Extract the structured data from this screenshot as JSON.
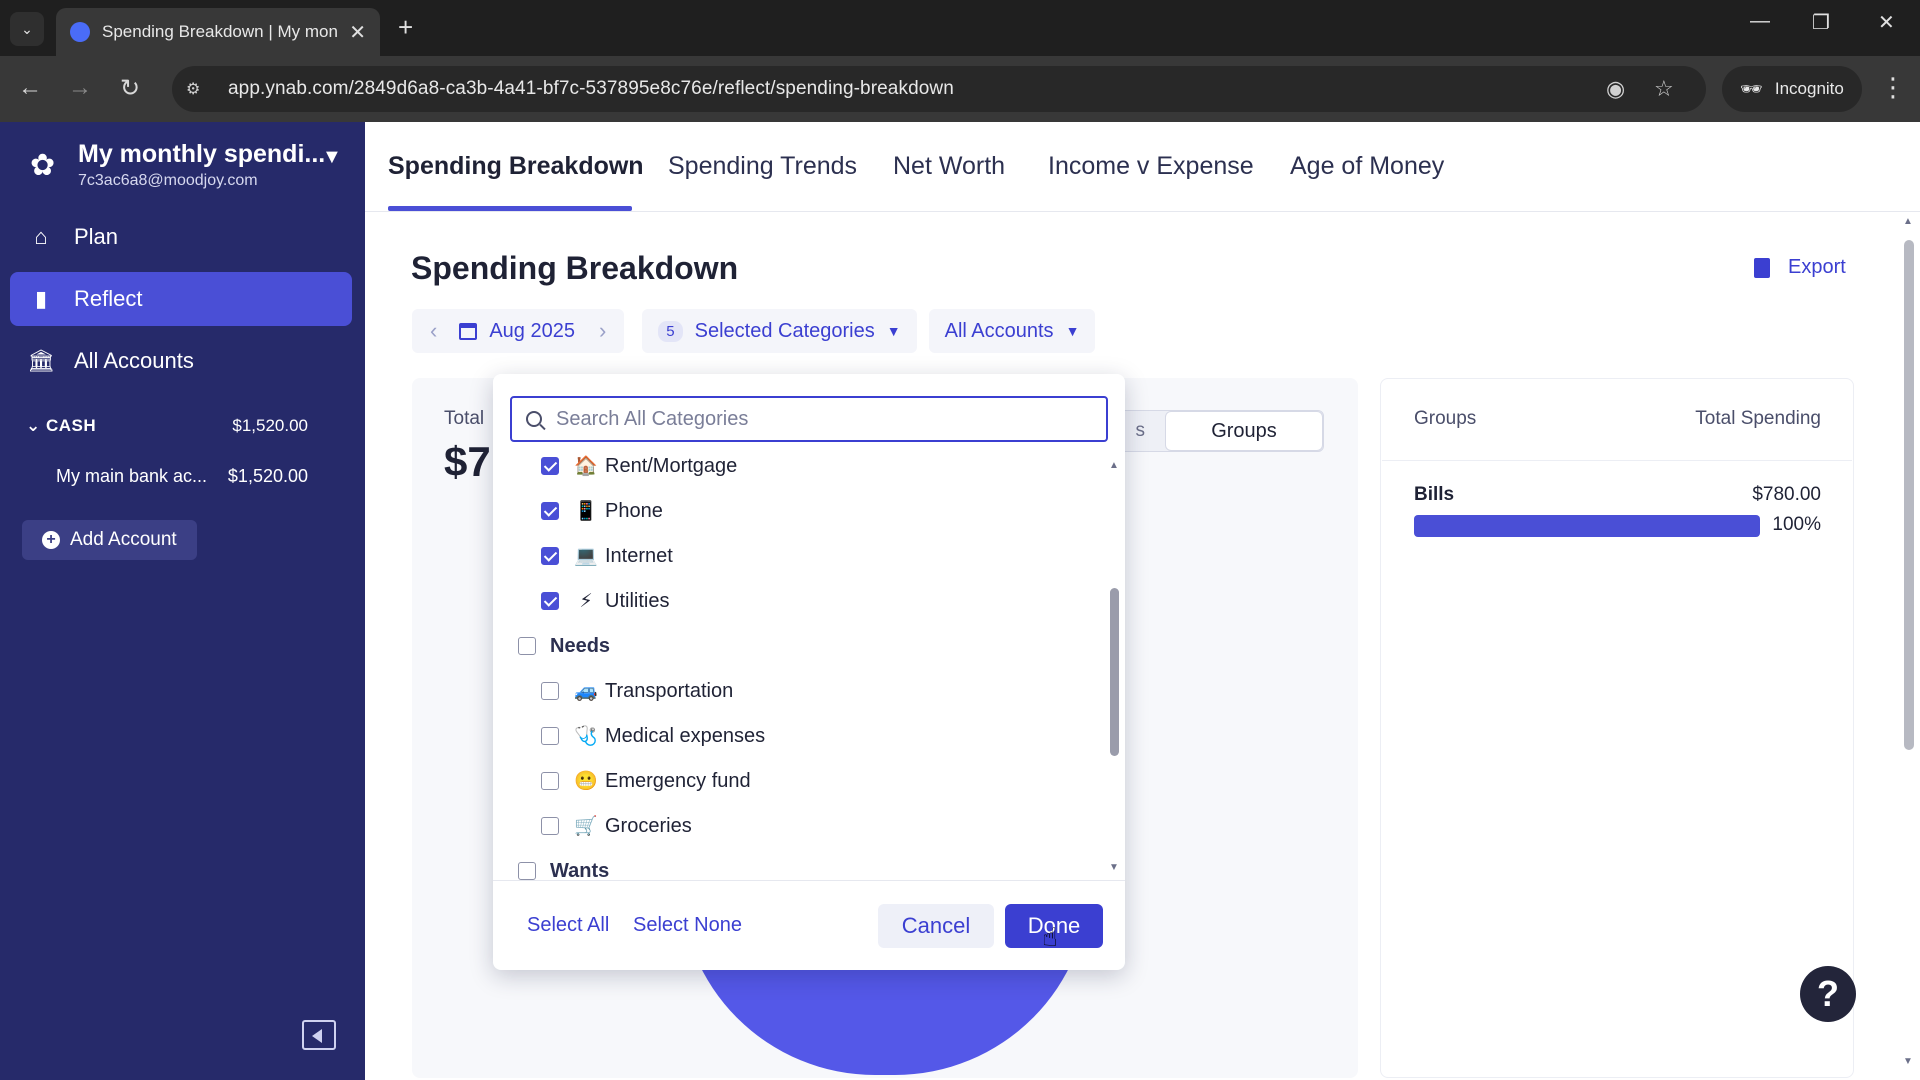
{
  "browser": {
    "tab_title": "Spending Breakdown | My mon",
    "url": "app.ynab.com/2849d6a8-ca3b-4a41-bf7c-537895e8c76e/reflect/spending-breakdown",
    "incognito_label": "Incognito"
  },
  "sidebar": {
    "budget_name": "My monthly spendi...",
    "budget_email": "7c3ac6a8@moodjoy.com",
    "nav": [
      {
        "label": "Plan",
        "icon": "plan-icon"
      },
      {
        "label": "Reflect",
        "icon": "bar-chart-icon"
      },
      {
        "label": "All Accounts",
        "icon": "bank-icon"
      }
    ],
    "cash_label": "CASH",
    "cash_total": "$1,520.00",
    "account_name": "My main bank ac...",
    "account_balance": "$1,520.00",
    "add_account_label": "Add Account"
  },
  "report_tabs": [
    "Spending Breakdown",
    "Spending Trends",
    "Net Worth",
    "Income v Expense",
    "Age of Money"
  ],
  "page": {
    "title": "Spending Breakdown",
    "export_label": "Export",
    "date_label": "Aug 2025",
    "selected_count": "5",
    "categories_label": "Selected Categories",
    "accounts_label": "All Accounts",
    "total_label": "Total",
    "total_value_partial": "$7",
    "toggle_partial": "s",
    "toggle_groups": "Groups"
  },
  "groups_table": {
    "col_groups": "Groups",
    "col_total": "Total Spending",
    "rows": [
      {
        "name": "Bills",
        "amount": "$780.00",
        "percent": "100%",
        "fraction": 1.0
      }
    ]
  },
  "dropdown": {
    "search_placeholder": "Search All Categories",
    "items": [
      {
        "label": "Rent/Mortgage",
        "icon": "house-icon",
        "glyph": "🏠",
        "checked": true,
        "level": "category"
      },
      {
        "label": "Phone",
        "icon": "phone-icon",
        "glyph": "📱",
        "checked": true,
        "level": "category"
      },
      {
        "label": "Internet",
        "icon": "laptop-icon",
        "glyph": "💻",
        "checked": true,
        "level": "category"
      },
      {
        "label": "Utilities",
        "icon": "lightning-icon",
        "glyph": "⚡",
        "checked": true,
        "level": "category"
      },
      {
        "label": "Needs",
        "checked": false,
        "level": "group"
      },
      {
        "label": "Transportation",
        "icon": "car-icon",
        "glyph": "🚙",
        "checked": false,
        "level": "category"
      },
      {
        "label": "Medical expenses",
        "icon": "stethoscope-icon",
        "glyph": "🩺",
        "checked": false,
        "level": "category"
      },
      {
        "label": "Emergency fund",
        "icon": "grimace-face-icon",
        "glyph": "😬",
        "checked": false,
        "level": "category"
      },
      {
        "label": "Groceries",
        "icon": "cart-icon",
        "glyph": "🛒",
        "checked": false,
        "level": "category"
      },
      {
        "label": "Wants",
        "checked": false,
        "level": "group"
      }
    ],
    "select_all_label": "Select All",
    "select_none_label": "Select None",
    "cancel_label": "Cancel",
    "done_label": "Done"
  },
  "colors": {
    "sidebar_bg": "#262a6a",
    "accent": "#4a4fd6",
    "link": "#3b3fd1"
  }
}
